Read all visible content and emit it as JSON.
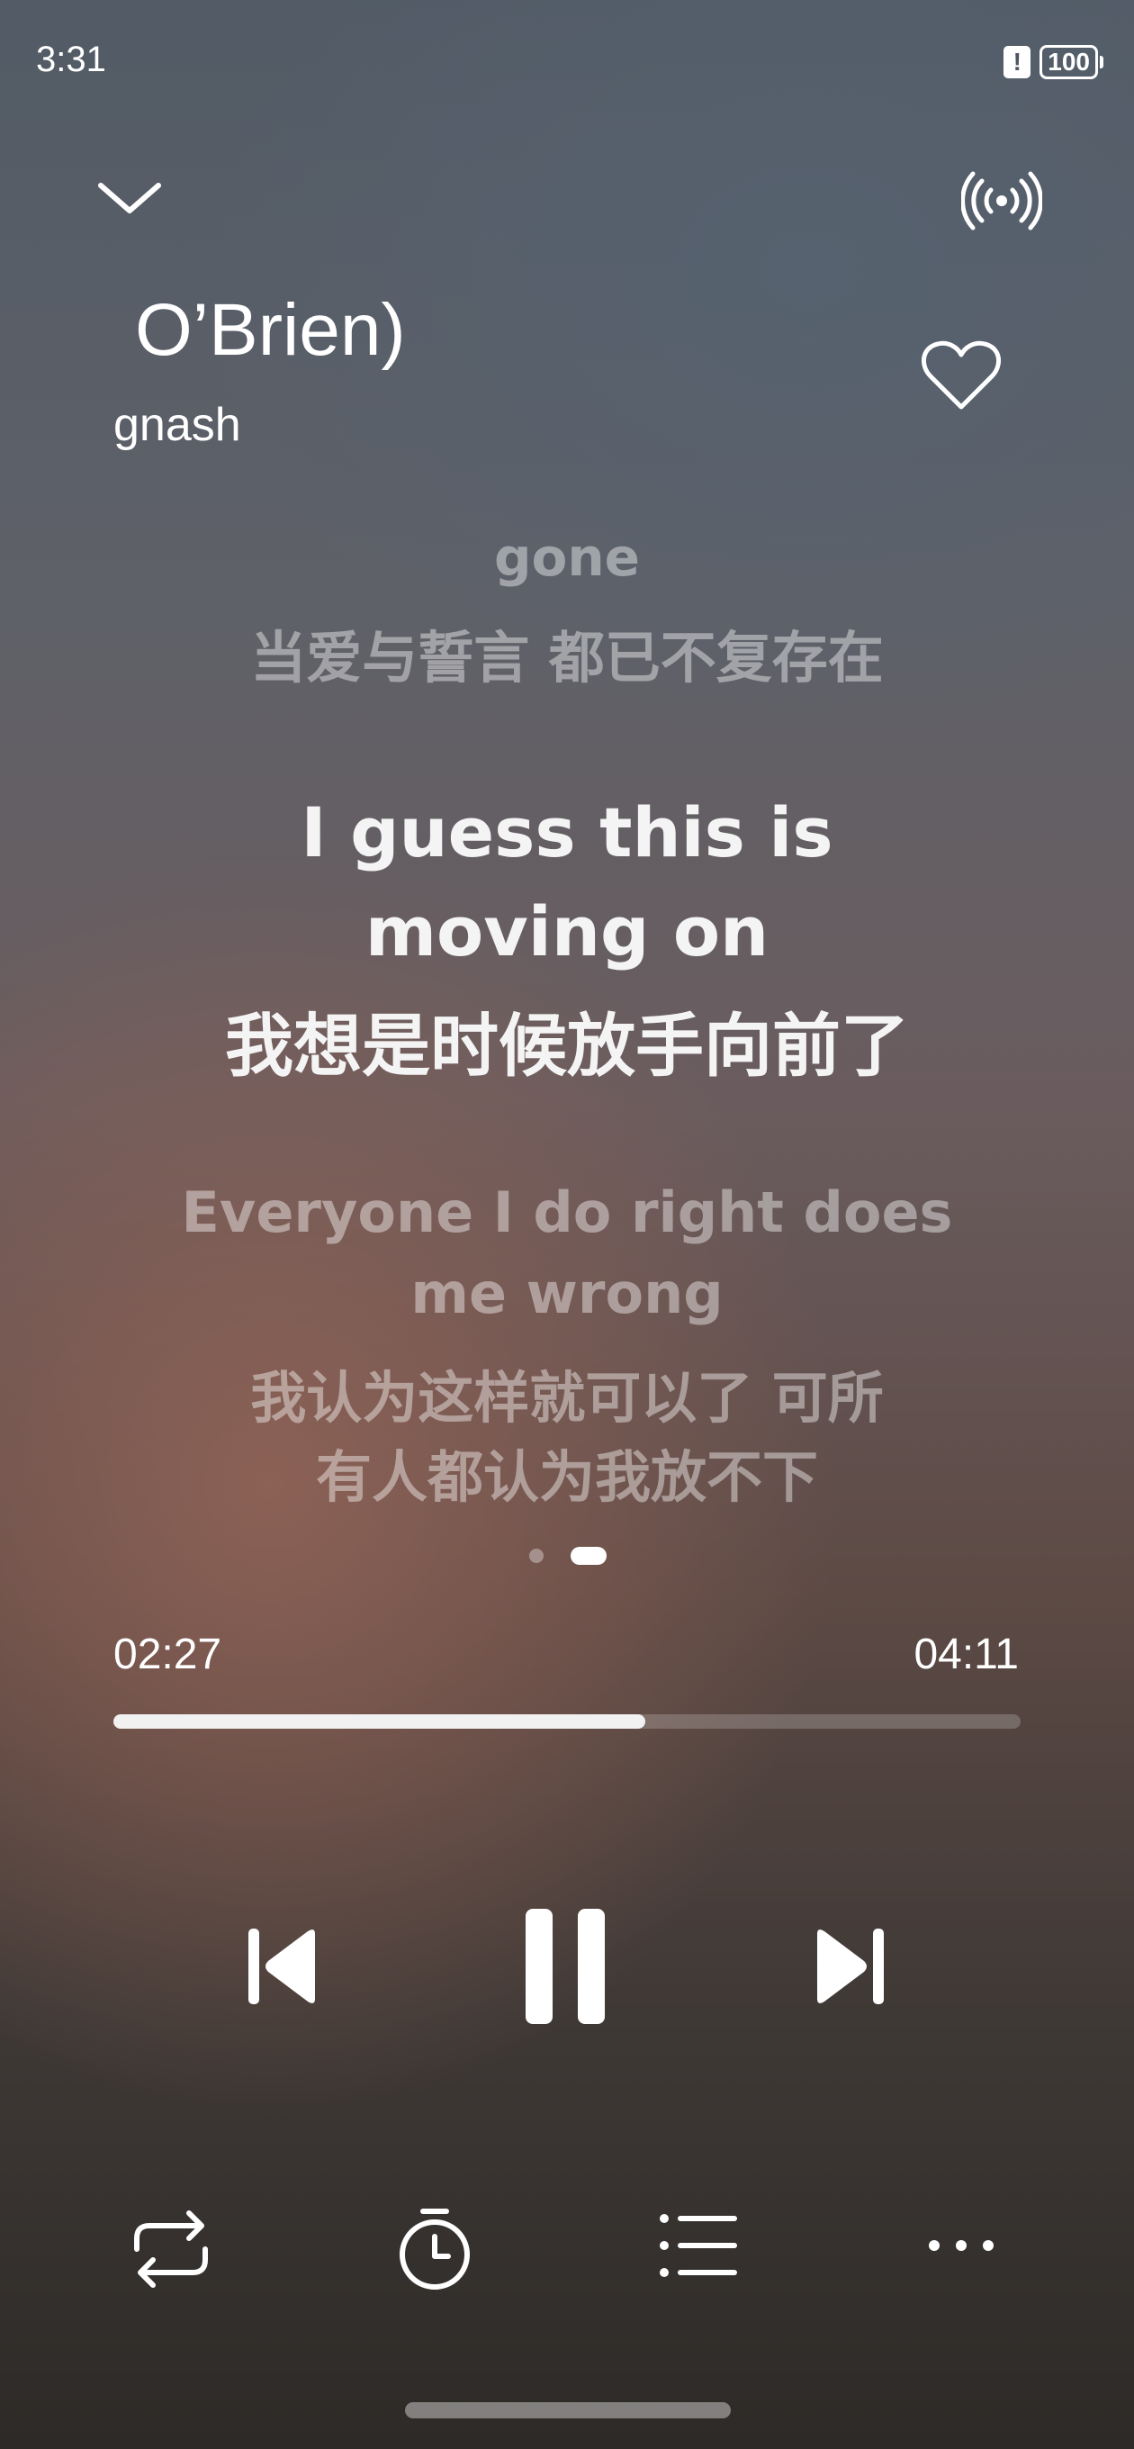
{
  "status_bar": {
    "time": "3:31",
    "alert_icon": "!",
    "battery": "100"
  },
  "header": {
    "collapse_icon": "chevron-down-icon",
    "cast_icon": "broadcast-icon"
  },
  "song": {
    "title": "O’Brien)",
    "artist": "gnash",
    "favorite_icon": "heart-outline-icon"
  },
  "lyrics": {
    "previous": {
      "en": "gone",
      "zh": "当爱与誓言 都已不复存在"
    },
    "current": {
      "en_line1": "I guess this is",
      "en_line2": "moving on",
      "zh": "我想是时候放手向前了"
    },
    "next": {
      "en_line1": "Everyone I do right does",
      "en_line2": "me wrong",
      "zh_line1": "我认为这样就可以了 可所",
      "zh_line2": "有人都认为我放不下"
    }
  },
  "pager": {
    "pages": 2,
    "active": 2
  },
  "progress": {
    "current_time": "02:27",
    "total_time": "04:11",
    "fraction": 0.586
  },
  "controls": {
    "previous_icon": "skip-previous-icon",
    "play_pause_icon": "pause-icon",
    "next_icon": "skip-next-icon"
  },
  "bottom_bar": {
    "repeat_icon": "repeat-icon",
    "timer_icon": "timer-icon",
    "playlist_icon": "playlist-icon",
    "more_icon": "more-icon"
  },
  "colors": {
    "text_primary": "#ffffff",
    "text_dim": "rgba(255,255,255,0.42)",
    "progress_fill": "#f1f1f1"
  }
}
